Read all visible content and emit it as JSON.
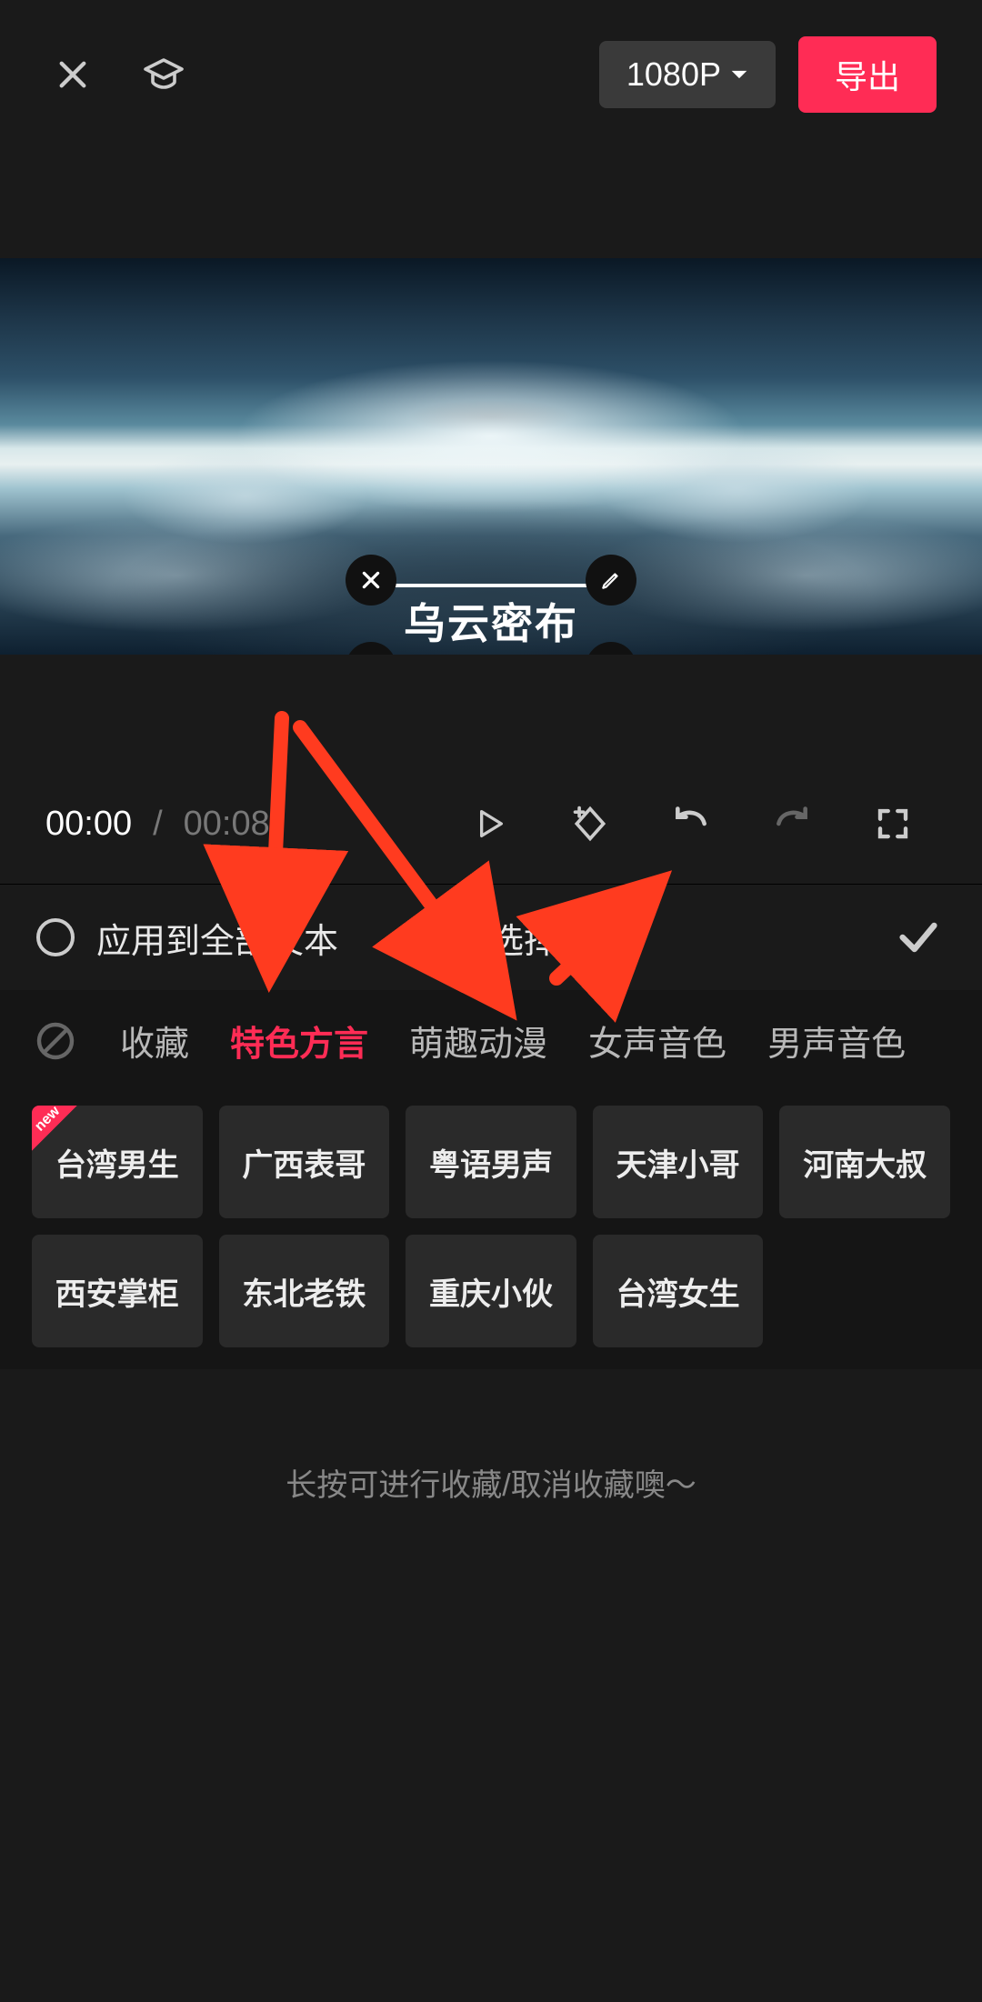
{
  "topbar": {
    "resolution_label": "1080P",
    "export_label": "导出"
  },
  "preview": {
    "text_overlay": "乌云密布"
  },
  "playback": {
    "time_current": "00:00",
    "time_total": "00:08"
  },
  "panel": {
    "apply_all_label": "应用到全部文本",
    "panel_title": "音色选择"
  },
  "categories": {
    "items": [
      {
        "label": "收藏",
        "active": false
      },
      {
        "label": "特色方言",
        "active": true
      },
      {
        "label": "萌趣动漫",
        "active": false
      },
      {
        "label": "女声音色",
        "active": false
      },
      {
        "label": "男声音色",
        "active": false
      }
    ]
  },
  "voices": {
    "items": [
      {
        "label": "台湾男生",
        "new": true
      },
      {
        "label": "广西表哥",
        "new": false
      },
      {
        "label": "粤语男声",
        "new": false
      },
      {
        "label": "天津小哥",
        "new": false
      },
      {
        "label": "河南大叔",
        "new": false
      },
      {
        "label": "西安掌柜",
        "new": false
      },
      {
        "label": "东北老铁",
        "new": false
      },
      {
        "label": "重庆小伙",
        "new": false
      },
      {
        "label": "台湾女生",
        "new": false
      }
    ]
  },
  "footer": {
    "hint": "长按可进行收藏/取消收藏噢～"
  },
  "annotations": {
    "arrows": [
      {
        "from": [
          310,
          790
        ],
        "to": [
          298,
          1044
        ]
      },
      {
        "from": [
          330,
          800
        ],
        "to": [
          540,
          1084
        ]
      },
      {
        "from": [
          612,
          1076
        ],
        "to": [
          704,
          990
        ]
      }
    ],
    "color": "#ff3b1f"
  }
}
